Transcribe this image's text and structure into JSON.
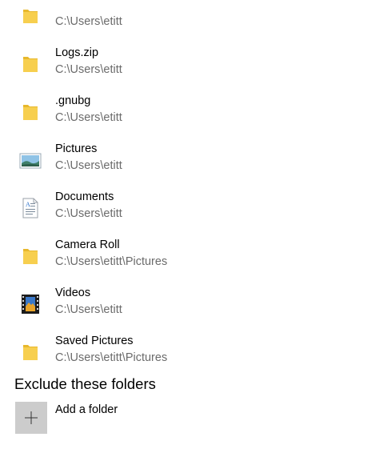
{
  "included_folders": [
    {
      "name": "",
      "path": "C:\\Users\\etitt",
      "icon": "folder-icon"
    },
    {
      "name": "Logs.zip",
      "path": "C:\\Users\\etitt",
      "icon": "folder-icon"
    },
    {
      "name": ".gnubg",
      "path": "C:\\Users\\etitt",
      "icon": "folder-icon"
    },
    {
      "name": "Pictures",
      "path": "C:\\Users\\etitt",
      "icon": "pictures-folder-icon"
    },
    {
      "name": "Documents",
      "path": "C:\\Users\\etitt",
      "icon": "documents-folder-icon"
    },
    {
      "name": "Camera Roll",
      "path": "C:\\Users\\etitt\\Pictures",
      "icon": "folder-icon"
    },
    {
      "name": "Videos",
      "path": "C:\\Users\\etitt",
      "icon": "videos-folder-icon"
    },
    {
      "name": "Saved Pictures",
      "path": "C:\\Users\\etitt\\Pictures",
      "icon": "folder-icon"
    }
  ],
  "exclude_section": {
    "title": "Exclude these folders",
    "add_label": "Add a folder",
    "add_icon": "plus-icon"
  },
  "colors": {
    "folder": "#f5c842",
    "path_text": "#6b6b6b",
    "add_tile": "#cccccc"
  }
}
